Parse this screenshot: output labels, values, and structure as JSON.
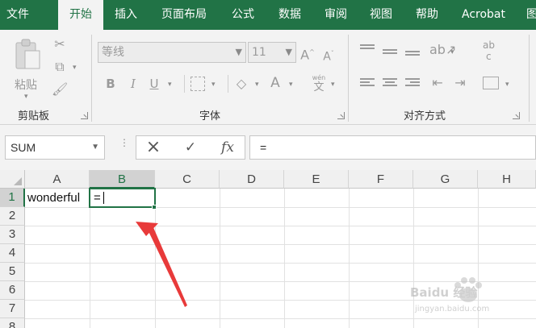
{
  "menu": {
    "items": [
      "文件",
      "开始",
      "插入",
      "页面布局",
      "公式",
      "数据",
      "审阅",
      "视图",
      "帮助",
      "Acrobat",
      "图"
    ],
    "active_index": 1
  },
  "ribbon": {
    "clipboard": {
      "paste_label": "粘贴",
      "group_label": "剪贴板"
    },
    "font": {
      "font_name": "等线",
      "font_size": "11",
      "bold": "B",
      "italic": "I",
      "underline": "U",
      "grow": "A",
      "shrink": "A",
      "font_color": "A",
      "phonetic_top": "wén",
      "phonetic_bottom": "文",
      "group_label": "字体"
    },
    "alignment": {
      "wrap_top": "ab",
      "wrap_bottom": "c",
      "group_label": "对齐方式"
    }
  },
  "formula_bar": {
    "name_box": "SUM",
    "cancel_icon": "×",
    "enter_icon": "✓",
    "fx_label": "fx",
    "formula": "="
  },
  "grid": {
    "columns": [
      "A",
      "B",
      "C",
      "D",
      "E",
      "F",
      "G",
      "H"
    ],
    "rows": [
      "1",
      "2",
      "3",
      "4",
      "5",
      "6",
      "7",
      "8"
    ],
    "selected_column": "B",
    "selected_row": "1",
    "cells": {
      "A1": "wonderful",
      "B1": "="
    }
  },
  "watermark": {
    "text": "Baidu 经验",
    "url": "jingyan.baidu.com"
  },
  "colors": {
    "accent": "#217346",
    "arrow": "#e83a3a"
  }
}
